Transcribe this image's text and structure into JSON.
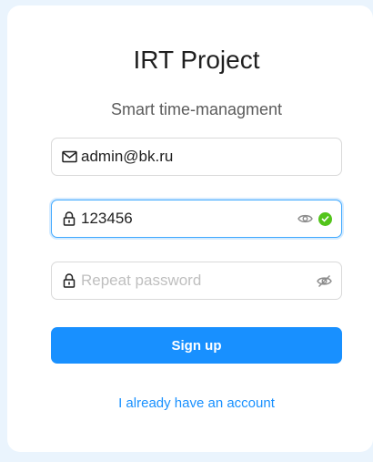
{
  "title": "IRT Project",
  "subtitle": "Smart time-managment",
  "email": {
    "value": "admin@bk.ru",
    "icon": "mail-icon"
  },
  "password": {
    "value": "123456",
    "icon": "lock-icon",
    "visibility_icon": "eye-icon",
    "status_icon": "check-circle-icon",
    "status_color": "#52c41a"
  },
  "repeat_password": {
    "value": "",
    "placeholder": "Repeat password",
    "icon": "lock-icon",
    "visibility_icon": "eye-invisible-icon"
  },
  "signup_button": {
    "label": "Sign up"
  },
  "account_link": {
    "label": "I already have an account"
  },
  "colors": {
    "primary": "#1890ff",
    "background": "#eaf4fd",
    "success": "#52c41a"
  }
}
